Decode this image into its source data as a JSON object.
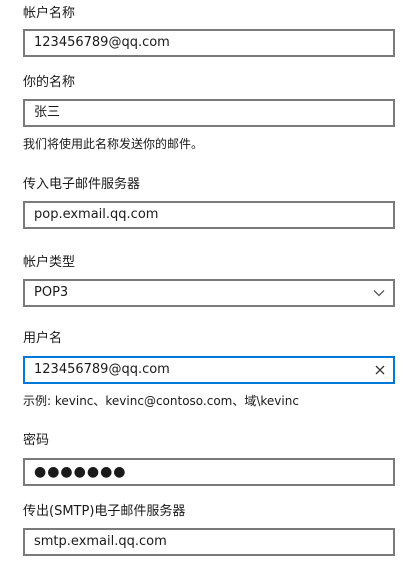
{
  "account_name": {
    "label": "帐户名称",
    "value": "123456789@qq.com"
  },
  "your_name": {
    "label": "你的名称",
    "value": "张三",
    "helper": "我们将使用此名称发送你的邮件。"
  },
  "incoming_server": {
    "label": "传入电子邮件服务器",
    "value": "pop.exmail.qq.com"
  },
  "account_type": {
    "label": "帐户类型",
    "value": "POP3"
  },
  "username": {
    "label": "用户名",
    "value": "123456789@qq.com",
    "helper": "示例: kevinc、kevinc@contoso.com、域\\kevinc"
  },
  "password": {
    "label": "密码",
    "value": "●●●●●●●"
  },
  "outgoing_server": {
    "label": "传出(SMTP)电子邮件服务器",
    "value": "smtp.exmail.qq.com"
  },
  "colors": {
    "focus_border": "#0078d7",
    "field_border": "#7a7a7a",
    "text": "#1a1a1a"
  },
  "icons": [
    "clear-icon",
    "chevron-down-icon"
  ]
}
